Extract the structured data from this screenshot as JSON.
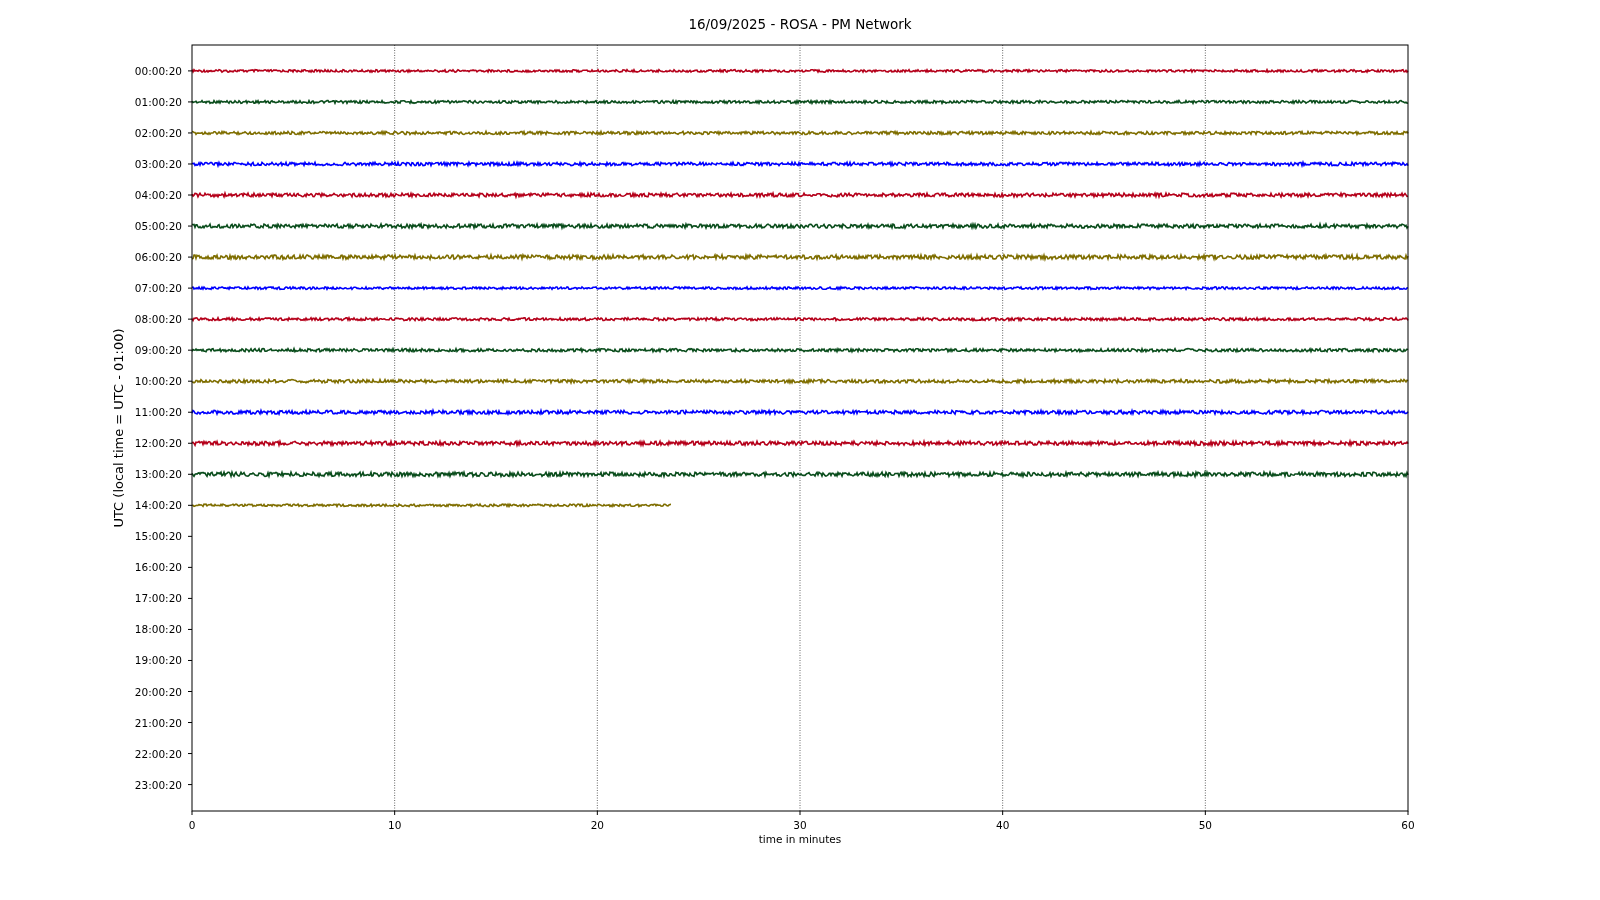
{
  "title": "16/09/2025 - ROSA - PM Network",
  "ylabel": "UTC (local time = UTC - 01:00)",
  "xlabel": "time in minutes",
  "xticks": [
    "0",
    "10",
    "20",
    "30",
    "40",
    "50",
    "60"
  ],
  "rows": [
    {
      "label": "00:00:20",
      "color": "#b5001a",
      "level": 1
    },
    {
      "label": "01:00:20",
      "color": "#0a4d1c",
      "level": 1
    },
    {
      "label": "02:00:20",
      "color": "#7f6e00",
      "level": 1
    },
    {
      "label": "03:00:20",
      "color": "#0000ff",
      "level": 1
    },
    {
      "label": "04:00:20",
      "color": "#b5001a",
      "level": 1
    },
    {
      "label": "05:00:20",
      "color": "#0a4d1c",
      "level": 1
    },
    {
      "label": "06:00:20",
      "color": "#7f6e00",
      "level": 1
    },
    {
      "label": "07:00:20",
      "color": "#0000ff",
      "level": 1
    },
    {
      "label": "08:00:20",
      "color": "#b5001a",
      "level": 1
    },
    {
      "label": "09:00:20",
      "color": "#0a4d1c",
      "level": 1
    },
    {
      "label": "10:00:20",
      "color": "#7f6e00",
      "level": 1
    },
    {
      "label": "11:00:20",
      "color": "#0000ff",
      "level": 1
    },
    {
      "label": "12:00:20",
      "color": "#b5001a",
      "level": 1
    },
    {
      "label": "13:00:20",
      "color": "#0a4d1c",
      "level": 1
    },
    {
      "label": "14:00:20",
      "color": "#7f6e00",
      "level": 0.394
    },
    {
      "label": "15:00:20"
    },
    {
      "label": "16:00:20"
    },
    {
      "label": "17:00:20"
    },
    {
      "label": "18:00:20"
    },
    {
      "label": "19:00:20"
    },
    {
      "label": "20:00:20"
    },
    {
      "label": "21:00:20"
    },
    {
      "label": "22:00:20"
    },
    {
      "label": "23:00:20"
    }
  ]
}
